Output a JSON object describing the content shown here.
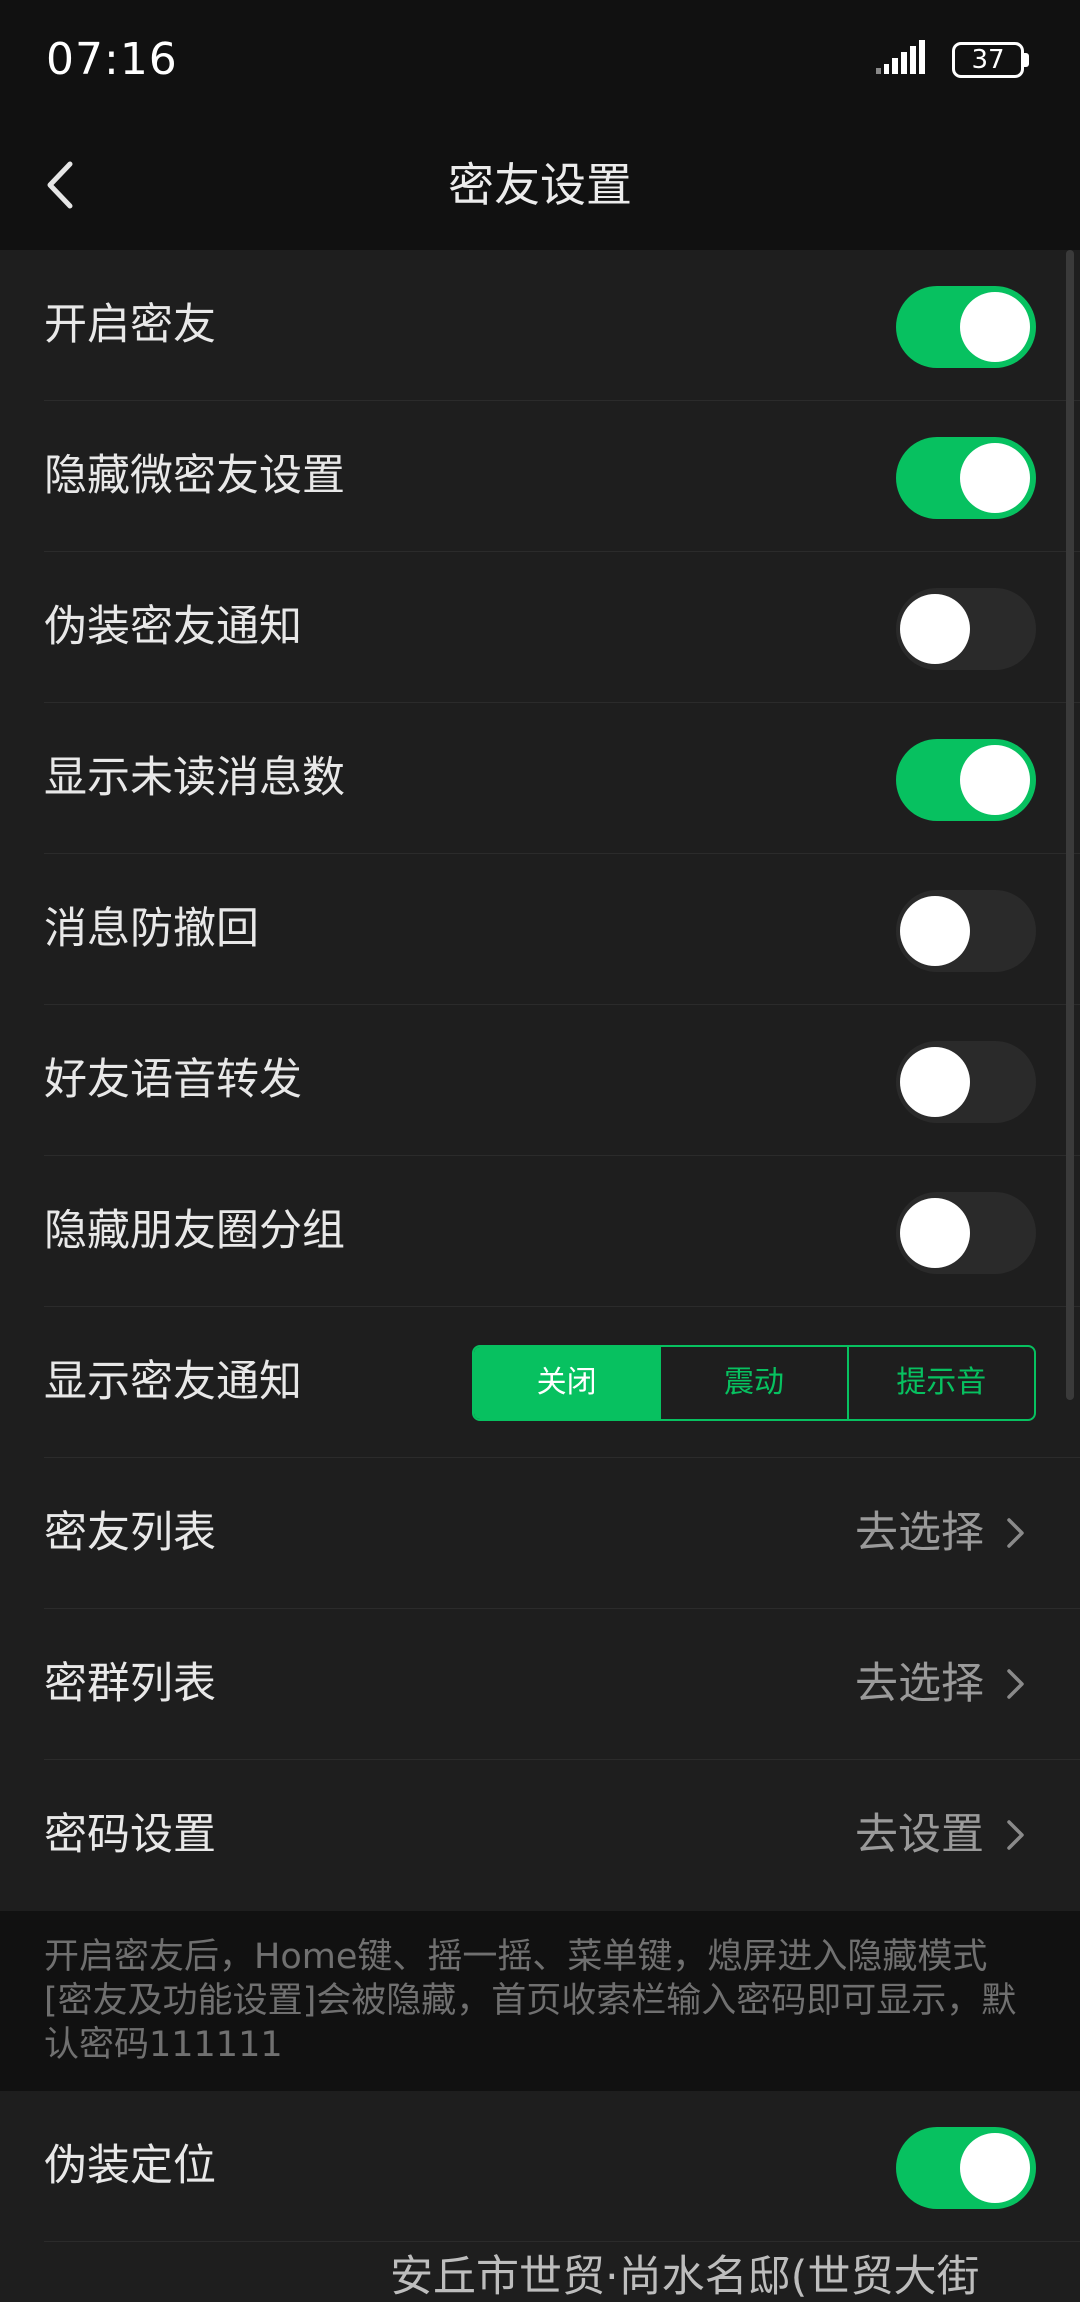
{
  "status_bar": {
    "time": "07:16",
    "battery": "37"
  },
  "nav": {
    "title": "密友设置"
  },
  "settings": [
    {
      "label": "开启密友",
      "type": "toggle",
      "on": true
    },
    {
      "label": "隐藏微密友设置",
      "type": "toggle",
      "on": true
    },
    {
      "label": "伪装密友通知",
      "type": "toggle",
      "on": false
    },
    {
      "label": "显示未读消息数",
      "type": "toggle",
      "on": true
    },
    {
      "label": "消息防撤回",
      "type": "toggle",
      "on": false
    },
    {
      "label": "好友语音转发",
      "type": "toggle",
      "on": false
    },
    {
      "label": "隐藏朋友圈分组",
      "type": "toggle",
      "on": false
    }
  ],
  "notify": {
    "label": "显示密友通知",
    "options": [
      "关闭",
      "震动",
      "提示音"
    ],
    "selected": "关闭"
  },
  "links": [
    {
      "label": "密友列表",
      "value": "去选择"
    },
    {
      "label": "密群列表",
      "value": "去选择"
    },
    {
      "label": "密码设置",
      "value": "去设置"
    }
  ],
  "note": "开启密友后，Home键、摇一摇、菜单键，熄屏进入隐藏模式[密友及功能设置]会被隐藏，首页收索栏输入密码即可显示，默认密码111111",
  "location": {
    "label": "伪装定位",
    "on": true,
    "partial_text": "安丘市世贸·尚水名邸(世贸大街"
  },
  "colors": {
    "accent": "#07c160",
    "background": "#111111",
    "row_background": "#1e1e1e"
  }
}
